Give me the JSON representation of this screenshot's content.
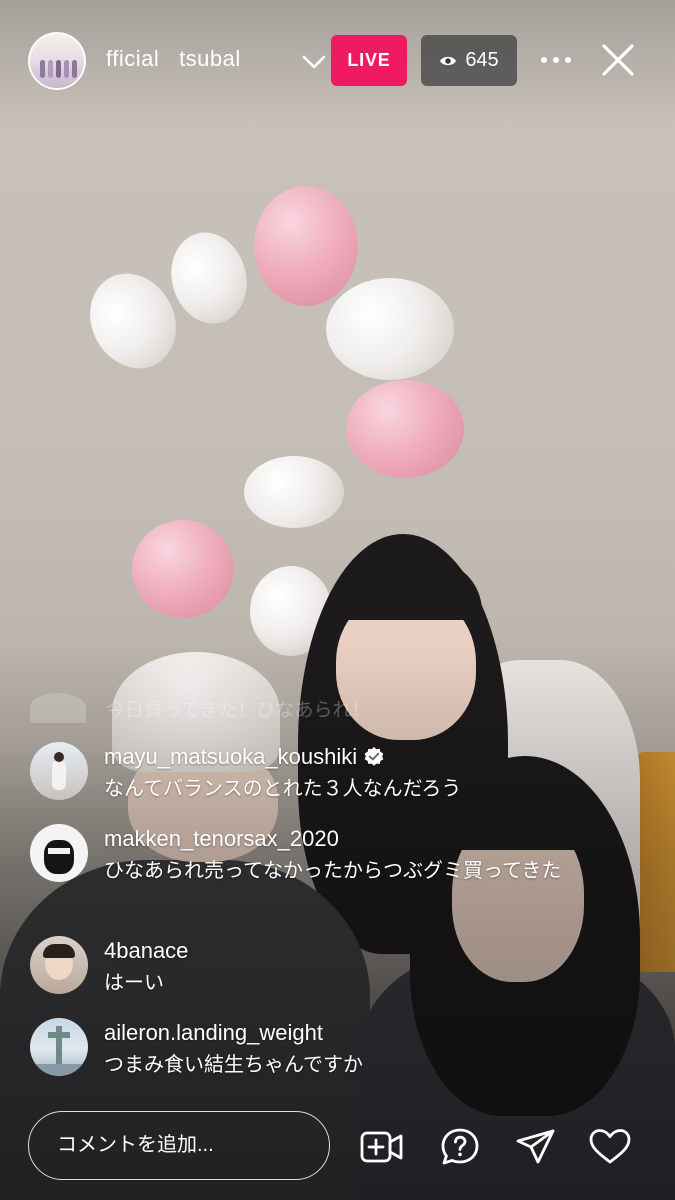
{
  "header": {
    "username": "fficial   tsubal",
    "live_label": "LIVE",
    "viewer_count": "645"
  },
  "comments": {
    "faded": {
      "text": "今日買ってきた！ひなあられ！"
    },
    "items": [
      {
        "user": "mayu_matsuoka_koushiki",
        "verified": true,
        "text": "なんてバランスのとれた３人なんだろう"
      },
      {
        "user": "makken_tenorsax_2020",
        "verified": false,
        "text": "ひなあられ売ってなかったからつぶグミ買ってきた"
      },
      {
        "user": "4banace",
        "verified": false,
        "text": "はーい"
      },
      {
        "user": "aileron.landing_weight",
        "verified": false,
        "text": "つまみ食い結生ちゃんですか"
      }
    ]
  },
  "footer": {
    "comment_placeholder": "コメントを追加..."
  },
  "colors": {
    "live_badge": "#ef1a62",
    "viewer_badge_bg": "rgba(60,60,60,0.72)"
  },
  "icons": {
    "top": [
      "chevron-down-icon",
      "eye-icon",
      "more-icon",
      "close-icon"
    ],
    "bottom": [
      "add-video-icon",
      "question-icon",
      "send-icon",
      "heart-icon"
    ]
  }
}
